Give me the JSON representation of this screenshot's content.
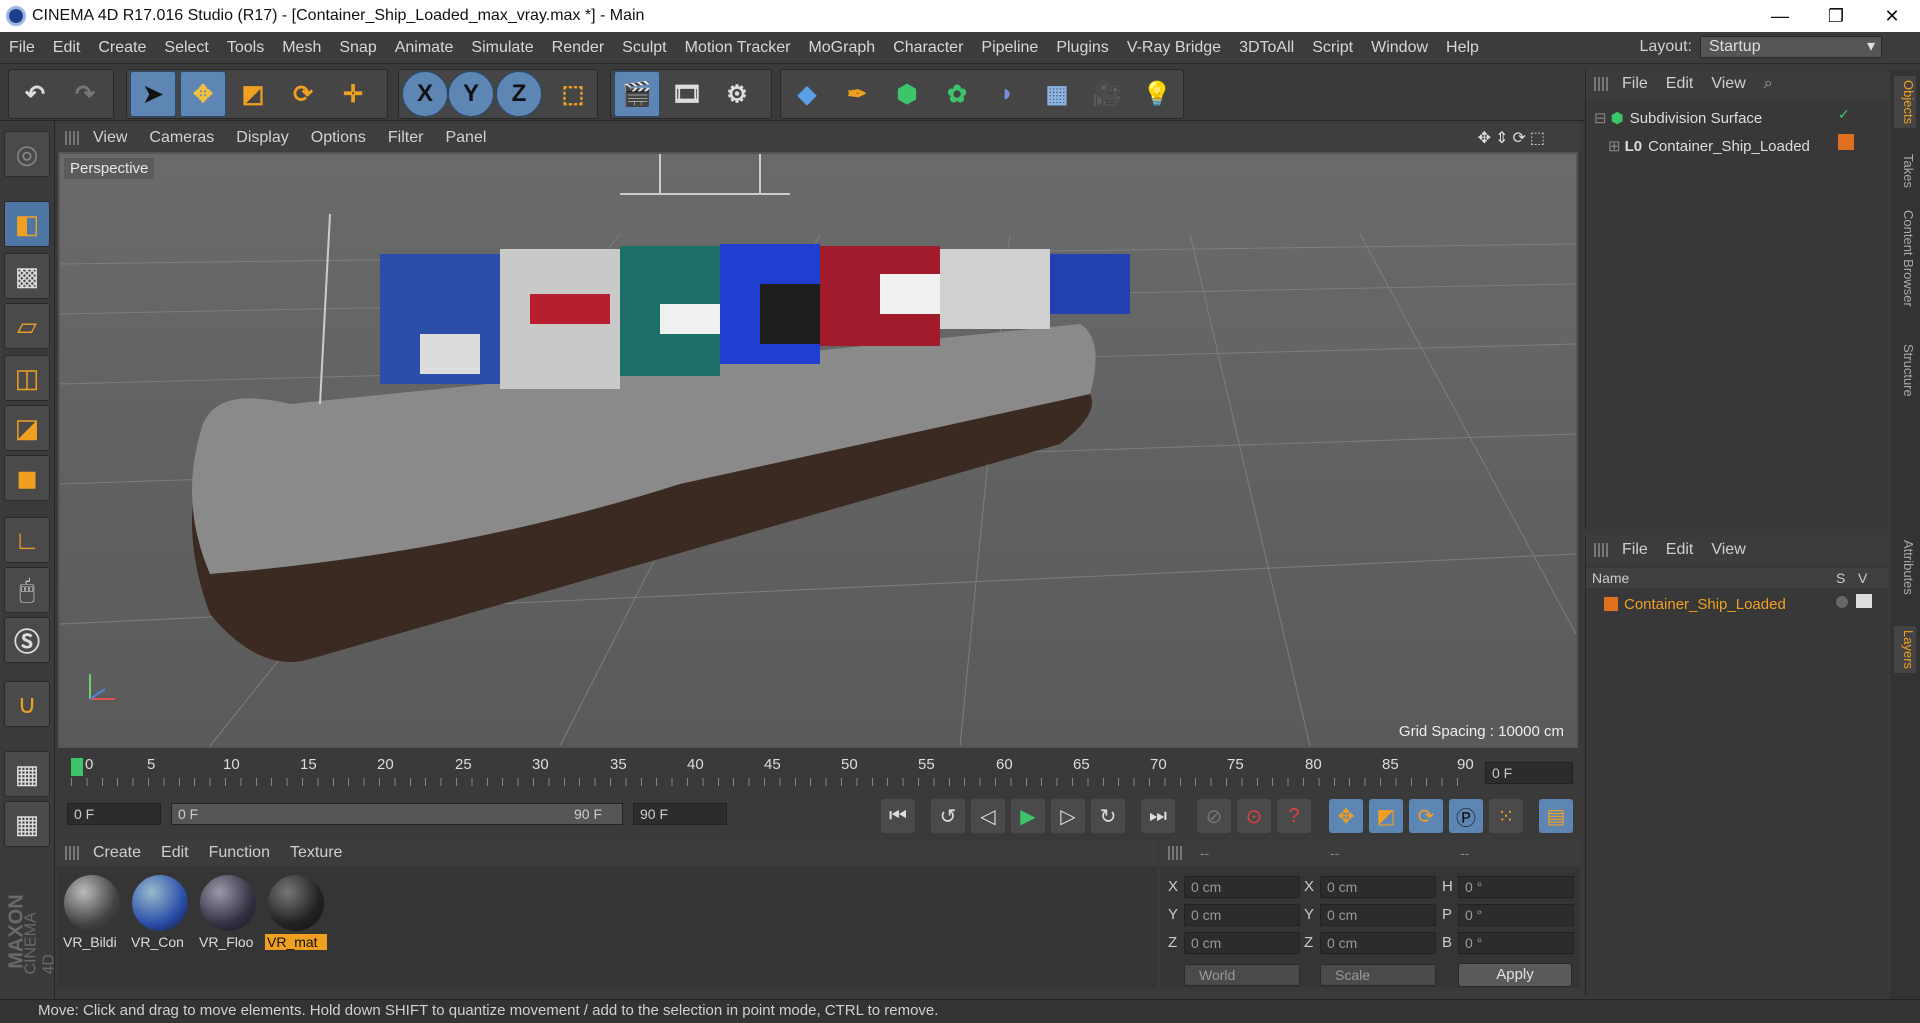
{
  "window": {
    "title": "CINEMA 4D R17.016 Studio (R17) - [Container_Ship_Loaded_max_vray.max *] - Main",
    "min": "—",
    "max": "❐",
    "close": "✕"
  },
  "menu": [
    "File",
    "Edit",
    "Create",
    "Select",
    "Tools",
    "Mesh",
    "Snap",
    "Animate",
    "Simulate",
    "Render",
    "Sculpt",
    "Motion Tracker",
    "MoGraph",
    "Character",
    "Pipeline",
    "Plugins",
    "V-Ray Bridge",
    "3DToAll",
    "Script",
    "Window",
    "Help"
  ],
  "layout": {
    "label": "Layout:",
    "value": "Startup"
  },
  "toolbar": {
    "x": "X",
    "y": "Y",
    "z": "Z"
  },
  "viewport_menu": [
    "View",
    "Cameras",
    "Display",
    "Options",
    "Filter",
    "Panel"
  ],
  "viewport": {
    "label": "Perspective",
    "grid_spacing": "Grid Spacing : 10000 cm"
  },
  "timeline": {
    "ticks": [
      "0",
      "5",
      "10",
      "15",
      "20",
      "25",
      "30",
      "35",
      "40",
      "45",
      "50",
      "55",
      "60",
      "65",
      "70",
      "75",
      "80",
      "85",
      "90"
    ],
    "current": "0 F"
  },
  "playback": {
    "start": "0 F",
    "range_start": "0 F",
    "range_end": "90 F",
    "end": "90 F"
  },
  "material_menu": [
    "Create",
    "Edit",
    "Function",
    "Texture"
  ],
  "materials": [
    {
      "name": "VR_Bildi",
      "selected": false
    },
    {
      "name": "VR_Con",
      "selected": false
    },
    {
      "name": "VR_Floo",
      "selected": false
    },
    {
      "name": "VR_mat",
      "selected": true
    }
  ],
  "coords": {
    "hdr": [
      "--",
      "--",
      "--"
    ],
    "rows": [
      {
        "l1": "X",
        "v1": "0 cm",
        "l2": "X",
        "v2": "0 cm",
        "l3": "H",
        "v3": "0 °"
      },
      {
        "l1": "Y",
        "v1": "0 cm",
        "l2": "Y",
        "v2": "0 cm",
        "l3": "P",
        "v3": "0 °"
      },
      {
        "l1": "Z",
        "v1": "0 cm",
        "l2": "Z",
        "v2": "0 cm",
        "l3": "B",
        "v3": "0 °"
      }
    ],
    "mode": "World",
    "scale": "Scale",
    "apply": "Apply"
  },
  "objects_menu": [
    "File",
    "Edit",
    "View"
  ],
  "objects": [
    {
      "name": "Subdivision Surface"
    },
    {
      "name": "Container_Ship_Loaded"
    }
  ],
  "layers_menu": [
    "File",
    "Edit",
    "View"
  ],
  "layers_cols": {
    "name": "Name",
    "s": "S",
    "v": "V"
  },
  "layers": [
    {
      "name": "Container_Ship_Loaded"
    }
  ],
  "side_tabs": [
    "Objects",
    "Takes",
    "Content Browser",
    "Structure",
    "Attributes",
    "Layers"
  ],
  "logo": {
    "maxon": "MAXON",
    "c4d": "CINEMA 4D"
  },
  "status": "Move: Click and drag to move elements. Hold down SHIFT to quantize movement / add to the selection in point mode, CTRL to remove.",
  "colors": {
    "accent": "#f0a020",
    "active_tool": "#5d86b4"
  }
}
